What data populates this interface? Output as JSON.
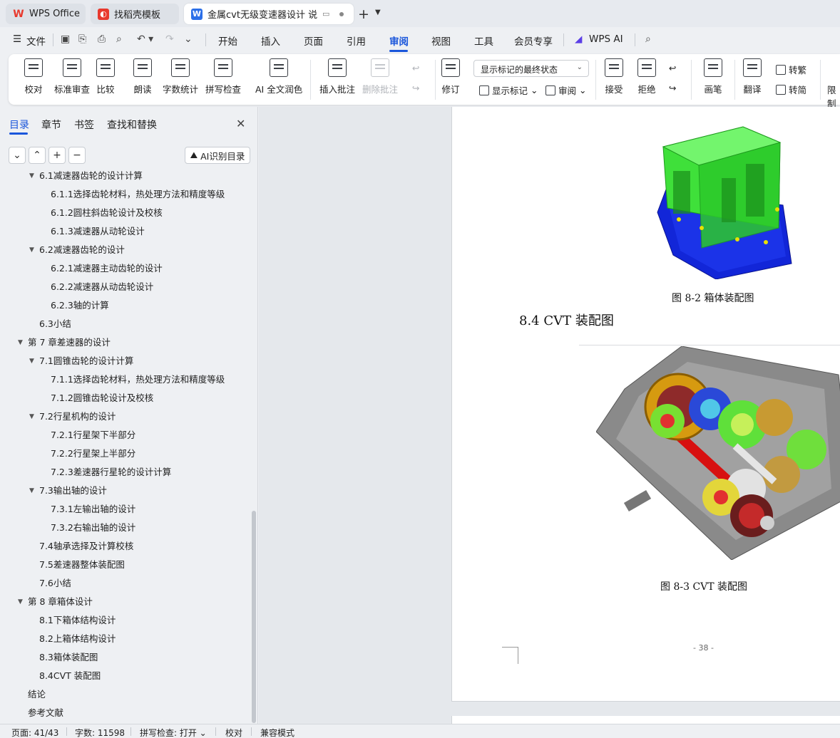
{
  "tabs": {
    "wps": "WPS Office",
    "template": "找稻壳模板",
    "doc": "金属cvt无级变速器设计 说明书"
  },
  "menu": {
    "file": "文件",
    "items": [
      "开始",
      "插入",
      "页面",
      "引用",
      "审阅",
      "视图",
      "工具",
      "会员专享"
    ],
    "active": "审阅",
    "wps_ai": "WPS AI"
  },
  "ribbon": {
    "proofread": "校对",
    "standard_review": "标准审查",
    "compare": "比较",
    "read_aloud": "朗读",
    "word_count": "字数统计",
    "spell_check": "拼写检查",
    "ai_polish": "AI 全文润色",
    "insert_comment": "插入批注",
    "delete_comment": "删除批注",
    "track_changes": "修订",
    "markup_state": "显示标记的最终状态",
    "show_markup": "显示标记",
    "review_pane": "审阅",
    "accept": "接受",
    "reject": "拒绝",
    "pen": "画笔",
    "translate": "翻译",
    "to_traditional": "转繁",
    "to_simplified": "转简",
    "restrict": "限制"
  },
  "sidebar": {
    "tabs": [
      "目录",
      "章节",
      "书签",
      "查找和替换"
    ],
    "ai_toc": "AI识别目录",
    "toc": [
      {
        "label": "6.1减速器齿轮的设计计算",
        "level": 2,
        "arrow": true
      },
      {
        "label": "6.1.1选择齿轮材料，热处理方法和精度等级",
        "level": 3
      },
      {
        "label": "6.1.2圆柱斜齿轮设计及校核",
        "level": 3
      },
      {
        "label": "6.1.3减速器从动轮设计",
        "level": 3
      },
      {
        "label": "6.2减速器齿轮的设计",
        "level": 2,
        "arrow": true
      },
      {
        "label": "6.2.1减速器主动齿轮的设计",
        "level": 3
      },
      {
        "label": "6.2.2减速器从动齿轮设计",
        "level": 3
      },
      {
        "label": "6.2.3轴的计算",
        "level": 3
      },
      {
        "label": "6.3小结",
        "level": 2
      },
      {
        "label": "第 7 章差速器的设计",
        "level": 1,
        "arrow": true
      },
      {
        "label": "7.1圆锥齿轮的设计计算",
        "level": 2,
        "arrow": true
      },
      {
        "label": "7.1.1选择齿轮材料，热处理方法和精度等级",
        "level": 3
      },
      {
        "label": "7.1.2圆锥齿轮设计及校核",
        "level": 3
      },
      {
        "label": "7.2行星机构的设计",
        "level": 2,
        "arrow": true
      },
      {
        "label": "7.2.1行星架下半部分",
        "level": 3
      },
      {
        "label": "7.2.2行星架上半部分",
        "level": 3
      },
      {
        "label": "7.2.3差速器行星轮的设计计算",
        "level": 3
      },
      {
        "label": "7.3输出轴的设计",
        "level": 2,
        "arrow": true
      },
      {
        "label": "7.3.1左输出轴的设计",
        "level": 3
      },
      {
        "label": "7.3.2右输出轴的设计",
        "level": 3
      },
      {
        "label": "7.4轴承选择及计算校核",
        "level": 2
      },
      {
        "label": "7.5差速器整体装配图",
        "level": 2
      },
      {
        "label": "7.6小结",
        "level": 2
      },
      {
        "label": "第 8 章箱体设计",
        "level": 1,
        "arrow": true
      },
      {
        "label": "8.1下箱体结构设计",
        "level": 2
      },
      {
        "label": "8.2上箱体结构设计",
        "level": 2
      },
      {
        "label": "8.3箱体装配图",
        "level": 2
      },
      {
        "label": "8.4CVT 装配图",
        "level": 2
      },
      {
        "label": "结论",
        "level": 1
      },
      {
        "label": "参考文献",
        "level": 1
      }
    ]
  },
  "document": {
    "caption1": "图 8-2 箱体装配图",
    "heading": "8.4  CVT 装配图",
    "caption2": "图 8-3 CVT 装配图",
    "page_number": "- 38 -"
  },
  "status": {
    "page": "页面: 41/43",
    "words": "字数: 11598",
    "spell": "拼写检查: 打开",
    "proof": "校对",
    "compat": "兼容模式"
  },
  "colors": {
    "accent": "#1a56db",
    "housing_green": "#3fe03a",
    "housing_blue": "#1226d8",
    "wps_red": "#e8392d"
  }
}
